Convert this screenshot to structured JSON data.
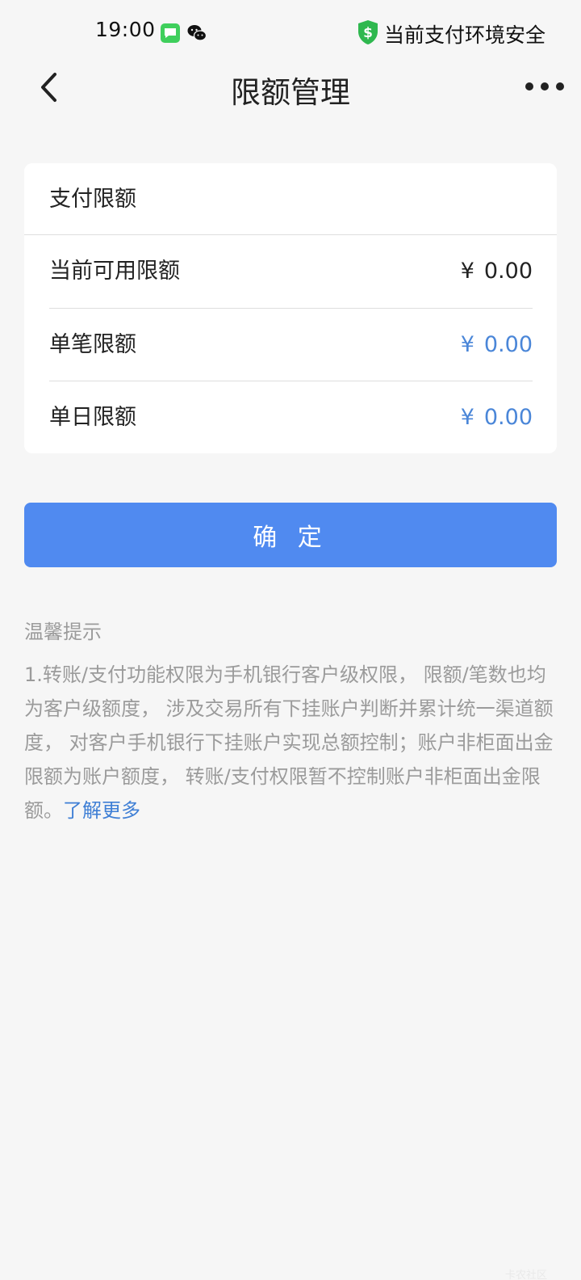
{
  "status_bar": {
    "time": "19:00",
    "security_text": "当前支付环境安全",
    "icons": [
      "message-app-icon",
      "wechat-icon",
      "shield-dollar-icon"
    ]
  },
  "nav": {
    "title": "限额管理",
    "icons": [
      "back-chevron-icon",
      "more-dots-icon"
    ]
  },
  "limits_card": {
    "title": "支付限额",
    "rows": [
      {
        "label": "当前可用限额",
        "currency": "¥",
        "amount": "0.00"
      },
      {
        "label": "单笔限额",
        "currency": "¥",
        "amount": "0.00"
      },
      {
        "label": "单日限额",
        "currency": "¥",
        "amount": "0.00"
      }
    ]
  },
  "confirm_label": "确 定",
  "tips": {
    "title": "温馨提示",
    "body": "1.转账/支付功能权限为手机银行客户级权限， 限额/笔数也均为客户级额度， 涉及交易所有下挂账户判断并累计统一渠道额度， 对客户手机银行下挂账户实现总额控制；账户非柜面出金限额为账户额度， 转账/支付权限暂不控制账户非柜面出金限额。",
    "link": "了解更多"
  },
  "watermark": "卡农社区",
  "colors": {
    "background": "#f6f6f6",
    "card": "#ffffff",
    "primary_button": "#508af0",
    "editable_value": "#4a86d8",
    "link": "#3f7fd5",
    "hint_text": "#9b9b9b",
    "shield": "#2fb84f"
  }
}
